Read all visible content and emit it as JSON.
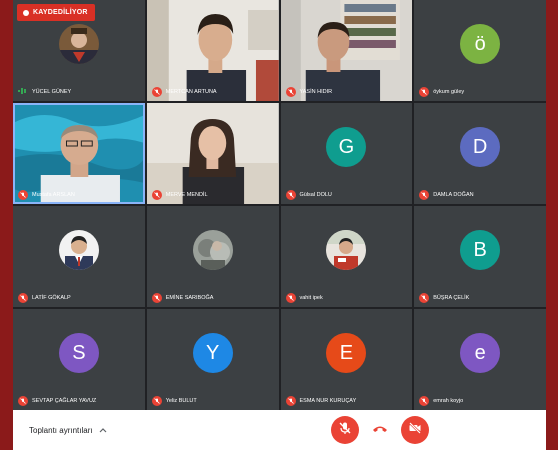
{
  "recording_label": "KAYDEDİLİYOR",
  "participants": [
    {
      "name": "YÜCEL GÜNEY",
      "type": "photo"
    },
    {
      "name": "MERTCAN ARTUNA",
      "type": "video"
    },
    {
      "name": "YASİN HIDIR",
      "type": "video"
    },
    {
      "name": "öykum güley",
      "type": "letter",
      "letter": "ö",
      "color": "#7cb342"
    },
    {
      "name": "Mustafa ARSLAN",
      "type": "video"
    },
    {
      "name": "MERVE MENDİL",
      "type": "video"
    },
    {
      "name": "Gülsal DOLU",
      "type": "letter",
      "letter": "G",
      "color": "#0f9d8f"
    },
    {
      "name": "DAMLA DOĞAN",
      "type": "letter",
      "letter": "D",
      "color": "#5c6bc0"
    },
    {
      "name": "LATİF GÖKALP",
      "type": "photo"
    },
    {
      "name": "EMİNE SARIBOĞA",
      "type": "photo"
    },
    {
      "name": "vahit ipek",
      "type": "photo"
    },
    {
      "name": "BÜŞRA ÇELİK",
      "type": "letter",
      "letter": "B",
      "color": "#0f9d8f"
    },
    {
      "name": "SEVTAP ÇAĞLAR YAVUZ",
      "type": "letter",
      "letter": "S",
      "color": "#7e57c2"
    },
    {
      "name": "Yeliz BULUT",
      "type": "letter",
      "letter": "Y",
      "color": "#1e88e5"
    },
    {
      "name": "ESMA NUR KURUÇAY",
      "type": "letter",
      "letter": "E",
      "color": "#e64a19"
    },
    {
      "name": "emrah koyjo",
      "type": "letter",
      "letter": "e",
      "color": "#7e57c2"
    }
  ],
  "bottom_bar": {
    "meeting_details_label": "Toplantı ayrıntıları"
  },
  "colors": {
    "recording": "#d93025",
    "mic_off": "#ea4335",
    "tile_bg": "#3c4043",
    "page_bg": "#202124"
  }
}
